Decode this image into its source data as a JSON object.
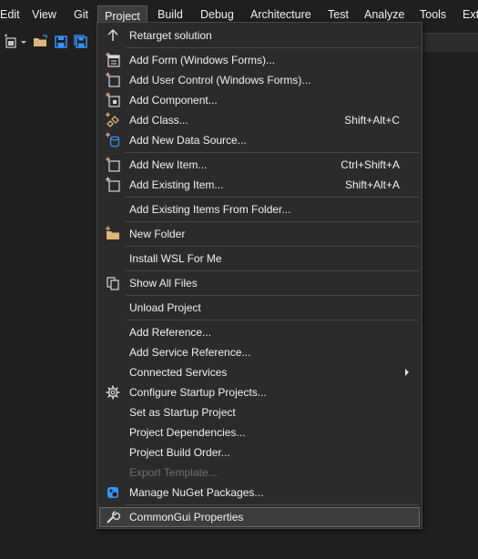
{
  "menubar": {
    "items": [
      "Edit",
      "Git",
      "Project",
      "Build",
      "Debug",
      "Architecture",
      "Test",
      "Analyze",
      "Tools",
      "Ext"
    ],
    "active": "Project"
  },
  "project_menu": {
    "items": [
      {
        "label": "Retarget solution",
        "shortcut": "",
        "icon": "arrow-up-icon"
      },
      {
        "label": "Add Form (Windows Forms)...",
        "shortcut": "",
        "icon": "add-form-icon"
      },
      {
        "label": "Add User Control (Windows Forms)...",
        "shortcut": "",
        "icon": "add-user-control-icon"
      },
      {
        "label": "Add Component...",
        "shortcut": "",
        "icon": "add-component-icon"
      },
      {
        "label": "Add Class...",
        "shortcut": "Shift+Alt+C",
        "icon": "add-class-icon"
      },
      {
        "label": "Add New Data Source...",
        "shortcut": "",
        "icon": "add-data-source-icon"
      },
      {
        "label": "Add New Item...",
        "shortcut": "Ctrl+Shift+A",
        "icon": "add-new-item-icon"
      },
      {
        "label": "Add Existing Item...",
        "shortcut": "Shift+Alt+A",
        "icon": "add-existing-item-icon"
      },
      {
        "label": "Add Existing Items From Folder...",
        "shortcut": "",
        "icon": ""
      },
      {
        "label": "New Folder",
        "shortcut": "",
        "icon": "new-folder-icon"
      },
      {
        "label": "Install WSL For Me",
        "shortcut": "",
        "icon": ""
      },
      {
        "label": "Show All Files",
        "shortcut": "",
        "icon": "show-all-files-icon"
      },
      {
        "label": "Unload Project",
        "shortcut": "",
        "icon": ""
      },
      {
        "label": "Add Reference...",
        "shortcut": "",
        "icon": ""
      },
      {
        "label": "Add Service Reference...",
        "shortcut": "",
        "icon": ""
      },
      {
        "label": "Connected Services",
        "shortcut": "",
        "icon": "",
        "submenu": true
      },
      {
        "label": "Configure Startup Projects...",
        "shortcut": "",
        "icon": "gear-icon"
      },
      {
        "label": "Set as Startup Project",
        "shortcut": "",
        "icon": ""
      },
      {
        "label": "Project Dependencies...",
        "shortcut": "",
        "icon": ""
      },
      {
        "label": "Project Build Order...",
        "shortcut": "",
        "icon": ""
      },
      {
        "label": "Export Template...",
        "shortcut": "",
        "icon": "",
        "disabled": true
      },
      {
        "label": "Manage NuGet Packages...",
        "shortcut": "",
        "icon": "nuget-icon"
      },
      {
        "label": "CommonGui Properties",
        "shortcut": "",
        "icon": "wrench-icon",
        "selected": true
      }
    ]
  },
  "colors": {
    "background": "#1f1f1f",
    "menu_bg": "#2b2b2b",
    "menu_border": "#474747",
    "accent_blue": "#3794ff",
    "folder_yellow": "#dcb67a",
    "disabled_text": "#6d6d6d"
  }
}
